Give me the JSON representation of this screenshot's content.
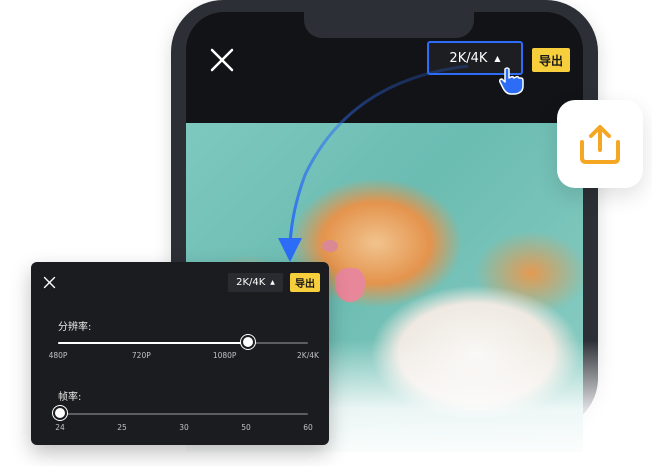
{
  "phone_toolbar": {
    "resolution_label": "2K/4K",
    "export_label": "导出"
  },
  "settings_panel": {
    "resolution_button_label": "2K/4K",
    "export_label": "导出",
    "resolution": {
      "label": "分辨率:",
      "options": [
        "480P",
        "720P",
        "1080P",
        "2K/4K"
      ],
      "selected_index": 2,
      "level_fraction": 0.76
    },
    "framerate": {
      "label": "帧率:",
      "options": [
        "24",
        "25",
        "30",
        "50",
        "60"
      ],
      "selected_index": 0,
      "level_fraction": 0.0
    }
  },
  "icons": {
    "close": "close-icon",
    "caret": "caret-up-icon",
    "upload": "upload-icon",
    "pointer": "hand-pointer-icon"
  },
  "colors": {
    "accent_blue": "#2d6cf6",
    "export_yellow": "#f7cf3c",
    "upload_orange": "#f5a623"
  }
}
